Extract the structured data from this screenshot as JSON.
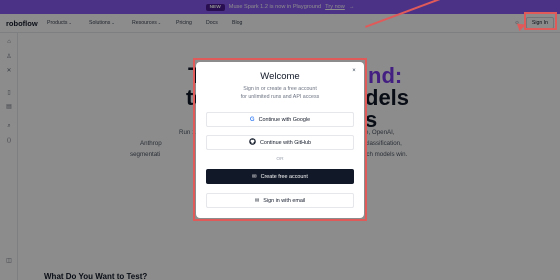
{
  "banner": {
    "badge": "NEW",
    "text": "Muse Spark 1.2 is now in Playground",
    "link": "Try now",
    "arrow": "→"
  },
  "navbar": {
    "logo": "roboflow",
    "items": [
      {
        "label": "Products",
        "chevron": "⌄"
      },
      {
        "label": "Solutions",
        "chevron": "⌄"
      },
      {
        "label": "Resources",
        "chevron": "⌄"
      },
      {
        "label": "Pricing"
      },
      {
        "label": "Docs"
      },
      {
        "label": "Blog"
      }
    ],
    "theme_icon": "sun-icon",
    "signin_label": "Sign In"
  },
  "sidebar": {
    "icons": [
      "home-icon",
      "user-icon",
      "tools-icon",
      "clipboard-icon",
      "document-icon",
      "search-icon",
      "code-icon",
      "panel-icon"
    ]
  },
  "hero": {
    "line1_start": "T",
    "line1_end": "nd:",
    "line2_start": "te",
    "line2_end": "dels",
    "line3_end": "s",
    "sub1_start": "Run 1",
    "sub1_end": "e, OpenAI,",
    "sub2_start": "Anthrop",
    "sub2_end": "classification,",
    "sub3_start": "segmentati",
    "sub3_end": "ich models win.",
    "section_title": "What Do You Want to Test?"
  },
  "modal": {
    "title": "Welcome",
    "close": "×",
    "subtitle_line1": "Sign in or create a free account",
    "subtitle_line2": "for unlimited runs and API access",
    "google_label": "Continue with Google",
    "github_label": "Continue with GitHub",
    "or_label": "OR",
    "create_label": "Create free account",
    "email_label": "Sign in with email"
  },
  "colors": {
    "banner": "#8b5cf6",
    "annotation": "#e05a5a",
    "accent": "#7c3aed"
  }
}
